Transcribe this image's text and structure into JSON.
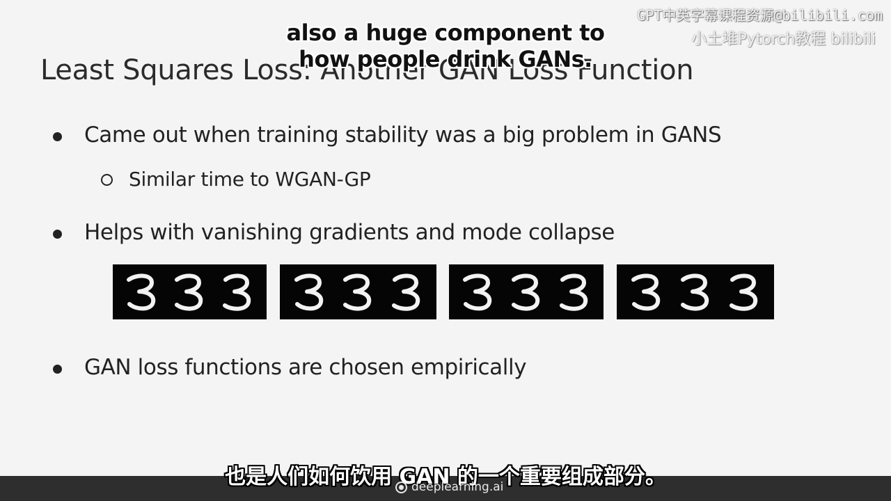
{
  "slide": {
    "title": "Least Squares Loss: Another GAN Loss Function",
    "bullets": [
      {
        "text": "Came out when training stability was a big problem in GANS",
        "sub": [
          "Similar time to WGAN-GP"
        ]
      },
      {
        "text": "Helps with vanishing gradients and mode collapse"
      },
      {
        "text": "GAN loss functions are chosen empirically"
      }
    ],
    "digit_strips": [
      {
        "digits": [
          "3",
          "3",
          "3"
        ]
      },
      {
        "digits": [
          "3",
          "3",
          "3"
        ]
      },
      {
        "digits": [
          "3",
          "3",
          "3"
        ]
      },
      {
        "digits": [
          "3",
          "3",
          "3"
        ]
      }
    ]
  },
  "subtitles": {
    "english_line_1": "also a huge component to",
    "english_line_2": "how people drink GANs.",
    "chinese": "也是人们如何饮用 GAN 的一个重要组成部分。"
  },
  "watermark": {
    "line_1": "GPT中英字幕课程资源@bilibili.com",
    "line_2": "小土堆Pytorch教程 bilibili"
  },
  "footer": {
    "brand": "deeplearning.ai",
    "brand_icon": "deeplearning-logo-icon"
  }
}
